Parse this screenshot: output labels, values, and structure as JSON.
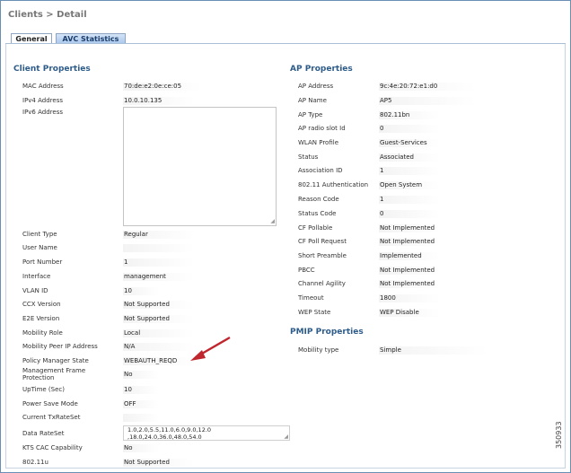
{
  "breadcrumb": "Clients > Detail",
  "tabs": [
    {
      "label": "General",
      "selected": true
    },
    {
      "label": "AVC Statistics",
      "selected": false
    }
  ],
  "client_properties": {
    "title": "Client Properties",
    "mac": {
      "label": "MAC Address",
      "value": "70:de:e2:0e:ce:05"
    },
    "ipv4": {
      "label": "IPv4 Address",
      "value": "10.0.10.135"
    },
    "ipv6": {
      "label": "IPv6 Address",
      "value": ""
    },
    "client_type": {
      "label": "Client Type",
      "value": "Regular"
    },
    "user_name": {
      "label": "User Name",
      "value": ""
    },
    "port_number": {
      "label": "Port Number",
      "value": "1"
    },
    "interface": {
      "label": "Interface",
      "value": "management"
    },
    "vlan_id": {
      "label": "VLAN ID",
      "value": "10"
    },
    "ccx_version": {
      "label": "CCX Version",
      "value": "Not Supported"
    },
    "e2e_version": {
      "label": "E2E Version",
      "value": "Not Supported"
    },
    "mobility_role": {
      "label": "Mobility Role",
      "value": "Local"
    },
    "mobility_peer_ip": {
      "label": "Mobility Peer IP Address",
      "value": "N/A"
    },
    "policy_manager_state": {
      "label": "Policy Manager State",
      "value": "WEBAUTH_REQD"
    },
    "mgmt_frame_protection": {
      "label_line1": "Management Frame",
      "label_line2": "Protection",
      "value": "No"
    },
    "uptime": {
      "label": "UpTime (Sec)",
      "value": "10"
    },
    "power_save_mode": {
      "label": "Power Save Mode",
      "value": "OFF"
    },
    "current_txrateset": {
      "label": "Current TxRateSet",
      "value": ""
    },
    "data_rateset": {
      "label": "Data RateSet",
      "line1": "1.0,2.0,5.5,11.0,6.0,9.0,12.0",
      "line2": ",18.0,24.0,36.0,48.0,54.0"
    },
    "kts_cac": {
      "label": "KTS CAC Capability",
      "value": "No"
    },
    "dot11u": {
      "label": "802.11u",
      "value": "Not Supported"
    }
  },
  "ap_properties": {
    "title": "AP Properties",
    "ap_address": {
      "label": "AP Address",
      "value": "9c:4e:20:72:e1:d0"
    },
    "ap_name": {
      "label": "AP Name",
      "value": "AP5"
    },
    "ap_type": {
      "label": "AP Type",
      "value": "802.11bn"
    },
    "ap_radio_slot": {
      "label": "AP radio slot Id",
      "value": "0"
    },
    "wlan_profile": {
      "label": "WLAN Profile",
      "value": "Guest-Services"
    },
    "status": {
      "label": "Status",
      "value": "Associated"
    },
    "association_id": {
      "label": "Association ID",
      "value": "1"
    },
    "auth": {
      "label": "802.11 Authentication",
      "value": "Open System"
    },
    "reason_code": {
      "label": "Reason Code",
      "value": "1"
    },
    "status_code": {
      "label": "Status Code",
      "value": "0"
    },
    "cf_pollable": {
      "label": "CF Pollable",
      "value": "Not Implemented"
    },
    "cf_poll_request": {
      "label": "CF Poll Request",
      "value": "Not Implemented"
    },
    "short_preamble": {
      "label": "Short Preamble",
      "value": "Implemented"
    },
    "pbcc": {
      "label": "PBCC",
      "value": "Not Implemented"
    },
    "channel_agility": {
      "label": "Channel Agility",
      "value": "Not Implemented"
    },
    "timeout": {
      "label": "Timeout",
      "value": "1800"
    },
    "wep_state": {
      "label": "WEP State",
      "value": "WEP Disable"
    }
  },
  "pmip_properties": {
    "title": "PMIP Properties",
    "mobility_type": {
      "label": "Mobility type",
      "value": "Simple"
    }
  },
  "annotation_arrow_color": "#c0262d",
  "figure_number": "350933"
}
